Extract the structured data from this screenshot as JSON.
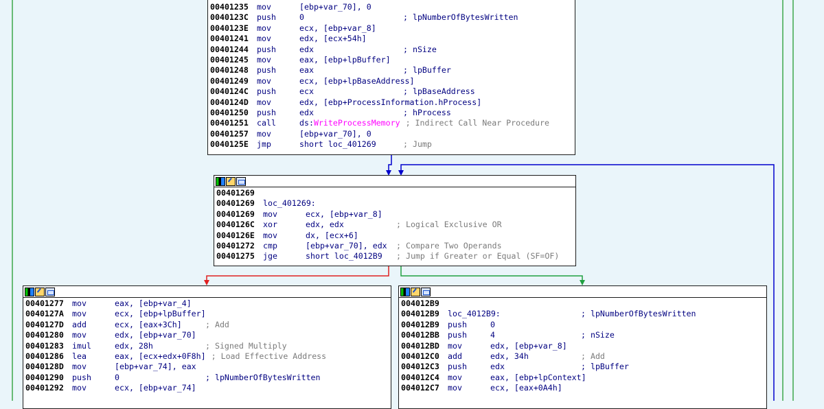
{
  "colors": {
    "background": "#eaf5fa",
    "edge_false": "#e02020",
    "edge_true": "#20a040",
    "edge_flow": "#0000cc",
    "outer_frame": "#3da84a"
  },
  "header_icons": [
    "node-color-icon",
    "rename-node-icon",
    "graph-overview-icon"
  ],
  "blocks": {
    "top": {
      "lines": [
        {
          "addr": "00401235",
          "mn": "mov ",
          "op": "[ebp+var_70], 0",
          "cm": ""
        },
        {
          "addr": "0040123C",
          "mn": "push",
          "op": "0",
          "cm": "; lpNumberOfBytesWritten"
        },
        {
          "addr": "0040123E",
          "mn": "mov ",
          "op": "ecx, [ebp+var_8]",
          "cm": ""
        },
        {
          "addr": "00401241",
          "mn": "mov ",
          "op": "edx, [ecx+54h]",
          "cm": ""
        },
        {
          "addr": "00401244",
          "mn": "push",
          "op": "edx",
          "cm": "; nSize"
        },
        {
          "addr": "00401245",
          "mn": "mov ",
          "op": "eax, [ebp+lpBuffer]",
          "cm": ""
        },
        {
          "addr": "00401248",
          "mn": "push",
          "op": "eax",
          "cm": "; lpBuffer"
        },
        {
          "addr": "00401249",
          "mn": "mov ",
          "op": "ecx, [ebp+lpBaseAddress]",
          "cm": ""
        },
        {
          "addr": "0040124C",
          "mn": "push",
          "op": "ecx",
          "cm": "; lpBaseAddress"
        },
        {
          "addr": "0040124D",
          "mn": "mov ",
          "op": "edx, [ebp+ProcessInformation.hProcess]",
          "cm": ""
        },
        {
          "addr": "00401250",
          "mn": "push",
          "op": "edx",
          "cm": "; hProcess"
        },
        {
          "addr": "00401251",
          "mn": "call",
          "op_pre": "ds:",
          "op_api": "WriteProcessMemory",
          "cm": "; Indirect Call Near Procedure"
        },
        {
          "addr": "00401257",
          "mn": "mov ",
          "op": "[ebp+var_70], 0",
          "cm": ""
        },
        {
          "addr": "0040125E",
          "mn": "jmp ",
          "op": "short loc_401269",
          "cm": "; Jump"
        }
      ]
    },
    "middle": {
      "lines": [
        {
          "addr": "00401269",
          "mn": "",
          "op": "",
          "cm": ""
        },
        {
          "addr": "00401269",
          "mn": "loc_401269:",
          "op": "",
          "cm": ""
        },
        {
          "addr": "00401269",
          "mn": "mov ",
          "op": "ecx, [ebp+var_8]",
          "cm": ""
        },
        {
          "addr": "0040126C",
          "mn": "xor ",
          "op": "edx, edx",
          "cm": "; Logical Exclusive OR"
        },
        {
          "addr": "0040126E",
          "mn": "mov ",
          "op": "dx, [ecx+6]",
          "cm": ""
        },
        {
          "addr": "00401272",
          "mn": "cmp ",
          "op": "[ebp+var_70], edx",
          "cm": "; Compare Two Operands"
        },
        {
          "addr": "00401275",
          "mn": "jge ",
          "op": "short loc_4012B9",
          "cm": "; Jump if Greater or Equal (SF=OF)"
        }
      ]
    },
    "left": {
      "lines": [
        {
          "addr": "00401277",
          "mn": "mov ",
          "op": "eax, [ebp+var_4]",
          "cm": ""
        },
        {
          "addr": "0040127A",
          "mn": "mov ",
          "op": "ecx, [ebp+lpBuffer]",
          "cm": ""
        },
        {
          "addr": "0040127D",
          "mn": "add ",
          "op": "ecx, [eax+3Ch]",
          "cm": "; Add"
        },
        {
          "addr": "00401280",
          "mn": "mov ",
          "op": "edx, [ebp+var_70]",
          "cm": ""
        },
        {
          "addr": "00401283",
          "mn": "imul",
          "op": "edx, 28h",
          "cm": "; Signed Multiply"
        },
        {
          "addr": "00401286",
          "mn": "lea ",
          "op": "eax, [ecx+edx+0F8h]",
          "cm": "; Load Effective Address"
        },
        {
          "addr": "0040128D",
          "mn": "mov ",
          "op": "[ebp+var_74], eax",
          "cm": ""
        },
        {
          "addr": "00401290",
          "mn": "push",
          "op": "0",
          "cm": "; lpNumberOfBytesWritten"
        },
        {
          "addr": "00401292",
          "mn": "mov ",
          "op": "ecx, [ebp+var_74]",
          "cm": ""
        }
      ]
    },
    "right": {
      "lines": [
        {
          "addr": "004012B9",
          "mn": "",
          "op": "",
          "cm": ""
        },
        {
          "addr": "004012B9",
          "mn": "loc_4012B9:",
          "op": "",
          "cm": "; lpNumberOfBytesWritten"
        },
        {
          "addr": "004012B9",
          "mn": "push",
          "op": "0",
          "cm": ""
        },
        {
          "addr": "004012BB",
          "mn": "push",
          "op": "4",
          "cm": "; nSize"
        },
        {
          "addr": "004012BD",
          "mn": "mov ",
          "op": "edx, [ebp+var_8]",
          "cm": ""
        },
        {
          "addr": "004012C0",
          "mn": "add ",
          "op": "edx, 34h",
          "cm": "; Add"
        },
        {
          "addr": "004012C3",
          "mn": "push",
          "op": "edx",
          "cm": "; lpBuffer"
        },
        {
          "addr": "004012C4",
          "mn": "mov ",
          "op": "eax, [ebp+lpContext]",
          "cm": ""
        },
        {
          "addr": "004012C7",
          "mn": "mov ",
          "op": "ecx, [eax+0A4h]",
          "cm": ""
        }
      ]
    }
  }
}
